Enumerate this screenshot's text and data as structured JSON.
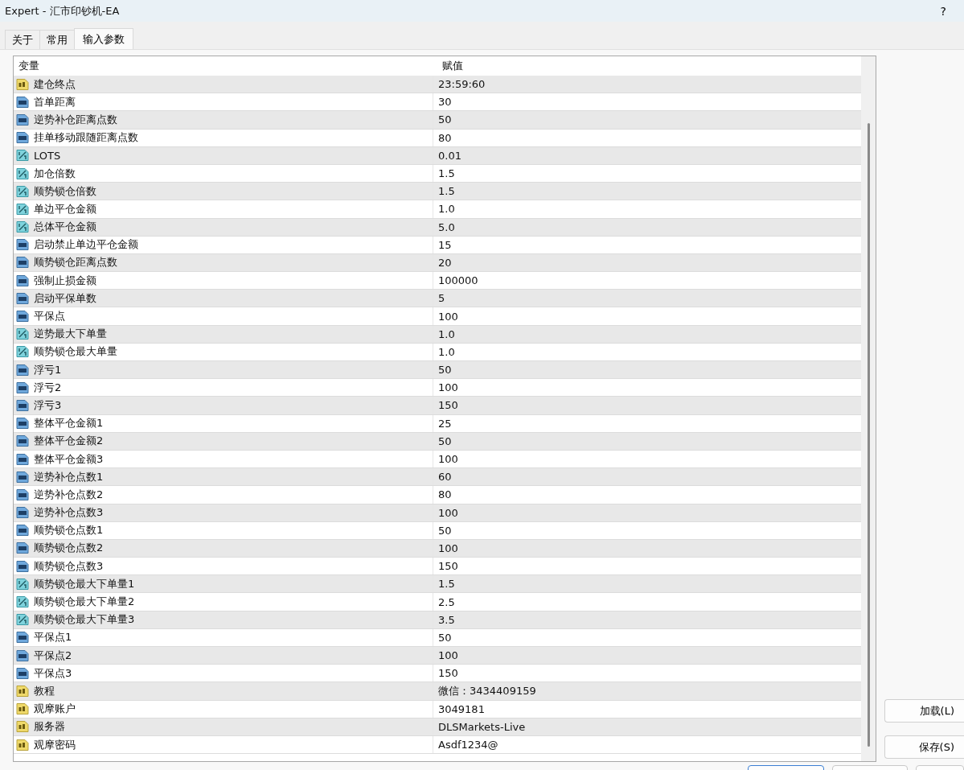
{
  "window": {
    "title": "Expert - 汇市印钞机-EA",
    "help": "?"
  },
  "tabs": [
    {
      "label": "关于",
      "selected": false
    },
    {
      "label": "常用",
      "selected": false
    },
    {
      "label": "输入参数",
      "selected": true
    }
  ],
  "table": {
    "columns": [
      "变量",
      "赋值"
    ],
    "rows": [
      {
        "kind": "string",
        "name": "建仓终点",
        "value": "23:59:60"
      },
      {
        "kind": "int",
        "name": "首单距离",
        "value": "30"
      },
      {
        "kind": "int",
        "name": "逆势补仓距离点数",
        "value": "50"
      },
      {
        "kind": "int",
        "name": "挂单移动跟随距离点数",
        "value": "80"
      },
      {
        "kind": "double",
        "name": "LOTS",
        "value": "0.01"
      },
      {
        "kind": "double",
        "name": "加仓倍数",
        "value": "1.5"
      },
      {
        "kind": "double",
        "name": "顺势锁仓倍数",
        "value": "1.5"
      },
      {
        "kind": "double",
        "name": "单边平仓金额",
        "value": "1.0"
      },
      {
        "kind": "double",
        "name": "总体平仓金额",
        "value": "5.0"
      },
      {
        "kind": "int",
        "name": "启动禁止单边平仓金额",
        "value": "15"
      },
      {
        "kind": "int",
        "name": "顺势锁仓距离点数",
        "value": "20"
      },
      {
        "kind": "int",
        "name": "强制止损金额",
        "value": "100000"
      },
      {
        "kind": "int",
        "name": "启动平保单数",
        "value": "5"
      },
      {
        "kind": "int",
        "name": "平保点",
        "value": "100"
      },
      {
        "kind": "double",
        "name": "逆势最大下单量",
        "value": "1.0"
      },
      {
        "kind": "double",
        "name": "顺势锁仓最大单量",
        "value": "1.0"
      },
      {
        "kind": "int",
        "name": "浮亏1",
        "value": "50"
      },
      {
        "kind": "int",
        "name": "浮亏2",
        "value": "100"
      },
      {
        "kind": "int",
        "name": "浮亏3",
        "value": "150"
      },
      {
        "kind": "int",
        "name": "整体平仓金额1",
        "value": "25"
      },
      {
        "kind": "int",
        "name": "整体平仓金额2",
        "value": "50"
      },
      {
        "kind": "int",
        "name": "整体平仓金额3",
        "value": "100"
      },
      {
        "kind": "int",
        "name": "逆势补仓点数1",
        "value": "60"
      },
      {
        "kind": "int",
        "name": "逆势补仓点数2",
        "value": "80"
      },
      {
        "kind": "int",
        "name": "逆势补仓点数3",
        "value": "100"
      },
      {
        "kind": "int",
        "name": "顺势锁仓点数1",
        "value": "50"
      },
      {
        "kind": "int",
        "name": "顺势锁仓点数2",
        "value": "100"
      },
      {
        "kind": "int",
        "name": "顺势锁仓点数3",
        "value": "150"
      },
      {
        "kind": "double",
        "name": "顺势锁仓最大下单量1",
        "value": "1.5"
      },
      {
        "kind": "double",
        "name": "顺势锁仓最大下单量2",
        "value": "2.5"
      },
      {
        "kind": "double",
        "name": "顺势锁仓最大下单量3",
        "value": "3.5"
      },
      {
        "kind": "int",
        "name": "平保点1",
        "value": "50"
      },
      {
        "kind": "int",
        "name": "平保点2",
        "value": "100"
      },
      {
        "kind": "int",
        "name": "平保点3",
        "value": "150"
      },
      {
        "kind": "string",
        "name": "教程",
        "value": "微信：3434409159"
      },
      {
        "kind": "string",
        "name": "观摩账户",
        "value": "3049181"
      },
      {
        "kind": "string",
        "name": "服务器",
        "value": "DLSMarkets-Live"
      },
      {
        "kind": "string",
        "name": "观摩密码",
        "value": "Asdf1234@"
      }
    ]
  },
  "buttons": [
    "加载(L)",
    "保存(S)"
  ]
}
